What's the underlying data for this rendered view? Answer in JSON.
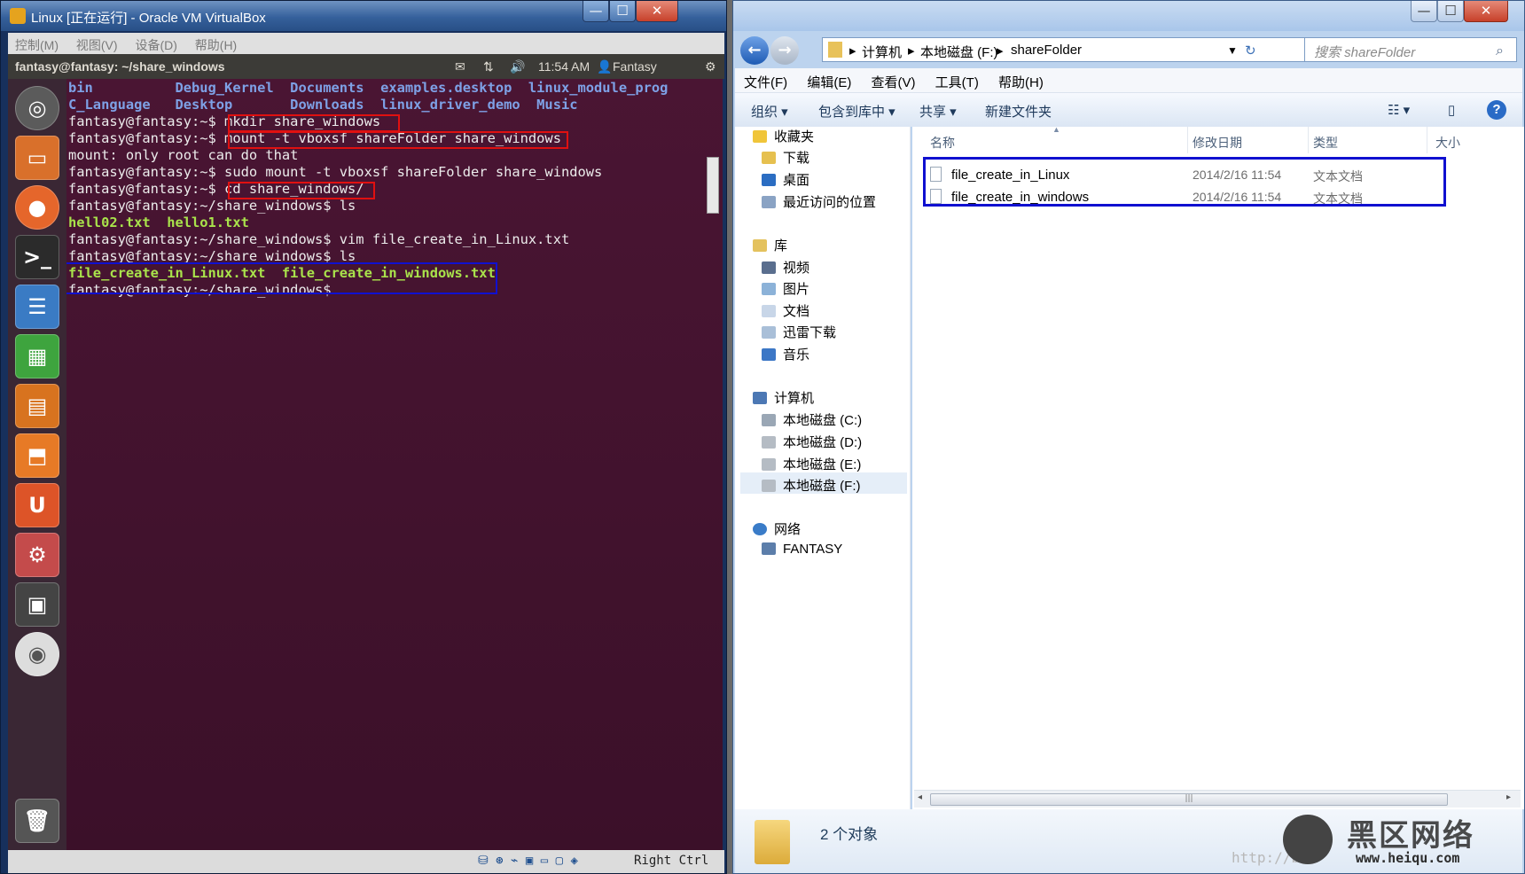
{
  "vbox": {
    "title": "Linux [正在运行] - Oracle VM VirtualBox",
    "menu": [
      "控制(M)",
      "视图(V)",
      "设备(D)",
      "帮助(H)"
    ],
    "min": "—",
    "max": "☐",
    "close": "✕"
  },
  "ubuntu": {
    "window_title": "fantasy@fantasy: ~/share_windows",
    "time": "11:54 AM",
    "user": "Fantasy"
  },
  "terminal": {
    "lines": [
      {
        "text": "bin          Debug_Kernel  Documents  examples.desktop  linux_module_prog",
        "style": "ls1"
      },
      {
        "text": "C_Language   Desktop       Downloads  linux_driver_demo  Music",
        "style": "ls2"
      },
      {
        "text": "fantasy@fantasy:~$ mkdir share_windows",
        "style": "plain"
      },
      {
        "text": "fantasy@fantasy:~$ mount -t vboxsf shareFolder share_windows",
        "style": "plain"
      },
      {
        "text": "mount: only root can do that",
        "style": "plain"
      },
      {
        "text": "fantasy@fantasy:~$ sudo mount -t vboxsf shareFolder share_windows",
        "style": "plain"
      },
      {
        "text": "fantasy@fantasy:~$ cd share_windows/",
        "style": "plain"
      },
      {
        "text": "fantasy@fantasy:~/share_windows$ ls",
        "style": "plain"
      },
      {
        "text": "hell02.txt  hello1.txt",
        "style": "green"
      },
      {
        "text": "fantasy@fantasy:~/share_windows$ vim file_create_in_Linux.txt",
        "style": "plain"
      },
      {
        "text": "fantasy@fantasy:~/share_windows$ ls",
        "style": "plain"
      },
      {
        "text": "file_create_in_Linux.txt  file_create_in_windows.txt",
        "style": "green"
      },
      {
        "text": "fantasy@fantasy:~/share_windows$",
        "style": "plain"
      }
    ]
  },
  "vbox_status": {
    "host_key": "Right Ctrl"
  },
  "explorer": {
    "breadcrumb": [
      "计算机",
      "本地磁盘 (F:)",
      "shareFolder"
    ],
    "search_placeholder": "搜索 shareFolder",
    "menu": [
      "文件(F)",
      "编辑(E)",
      "查看(V)",
      "工具(T)",
      "帮助(H)"
    ],
    "toolbar": {
      "organize": "组织 ▾",
      "include": "包含到库中 ▾",
      "share": "共享 ▾",
      "new_folder": "新建文件夹"
    },
    "nav": {
      "favorites": "收藏夹",
      "downloads": "下载",
      "desktop": "桌面",
      "recent": "最近访问的位置",
      "libraries": "库",
      "videos": "视频",
      "pictures": "图片",
      "documents": "文档",
      "thunder": "迅雷下载",
      "music": "音乐",
      "computer": "计算机",
      "disk_c": "本地磁盘 (C:)",
      "disk_d": "本地磁盘 (D:)",
      "disk_e": "本地磁盘 (E:)",
      "disk_f": "本地磁盘 (F:)",
      "network": "网络",
      "fantasy": "FANTASY"
    },
    "columns": {
      "name": "名称",
      "modified": "修改日期",
      "type": "类型",
      "size": "大小"
    },
    "files": [
      {
        "name": "file_create_in_Linux",
        "modified": "2014/2/16 11:54",
        "type": "文本文档"
      },
      {
        "name": "file_create_in_windows",
        "modified": "2014/2/16 11:54",
        "type": "文本文档"
      }
    ],
    "status": "2 个对象",
    "watermark": {
      "brand": "黑区网络",
      "url": "http://blo",
      "site": "www.heiqu.com"
    }
  },
  "colors": {
    "annot_red": "#e01010",
    "annot_blue": "#1010d0"
  }
}
